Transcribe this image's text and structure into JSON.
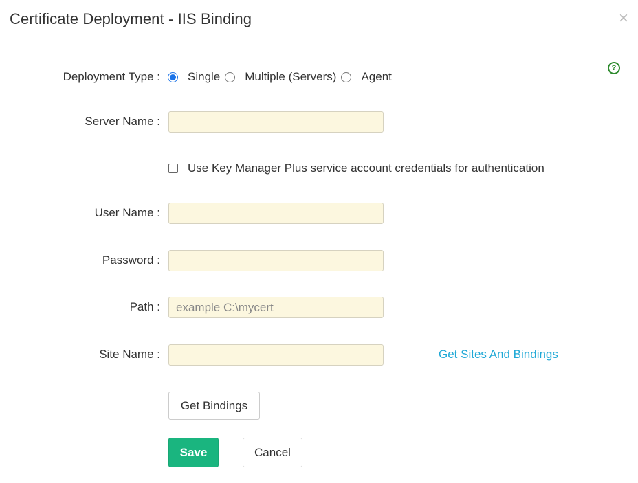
{
  "dialog": {
    "title": "Certificate Deployment - IIS Binding",
    "close_glyph": "×",
    "help_glyph": "?"
  },
  "deployment_type": {
    "label": "Deployment Type :",
    "options": [
      {
        "label": "Single",
        "selected": true
      },
      {
        "label": "Multiple (Servers)",
        "selected": false
      },
      {
        "label": "Agent",
        "selected": false
      }
    ]
  },
  "fields": {
    "server_name": {
      "label": "Server Name :",
      "value": "",
      "placeholder": ""
    },
    "user_name": {
      "label": "User Name :",
      "value": "",
      "placeholder": ""
    },
    "password": {
      "label": "Password :",
      "value": "",
      "placeholder": ""
    },
    "path": {
      "label": "Path :",
      "value": "",
      "placeholder": "example C:\\mycert"
    },
    "site_name": {
      "label": "Site Name :",
      "value": "",
      "placeholder": ""
    }
  },
  "service_account_checkbox": {
    "label": "Use Key Manager Plus service account credentials for authentication",
    "checked": false
  },
  "links": {
    "get_sites_and_bindings": "Get Sites And Bindings"
  },
  "buttons": {
    "get_bindings": "Get Bindings",
    "save": "Save",
    "cancel": "Cancel"
  },
  "colors": {
    "primary": "#1ab57f",
    "link": "#1fa8d6",
    "input_bg": "#fcf7df",
    "help": "#2e8b2e",
    "radio_selected": "#1a73e8"
  }
}
